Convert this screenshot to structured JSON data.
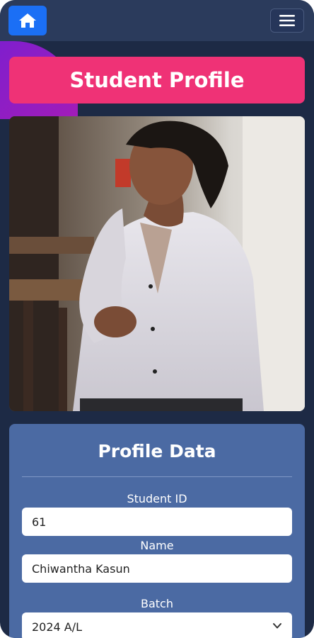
{
  "header": {
    "home_icon": "home-icon",
    "menu_icon": "hamburger-menu-icon",
    "accent": "#1b6ff5"
  },
  "banner": {
    "title": "Student Profile",
    "color": "#ef3276"
  },
  "photo": {
    "alt": "Student photo"
  },
  "profile_data": {
    "heading": "Profile Data",
    "fields": [
      {
        "label": "Student ID",
        "value": "61"
      },
      {
        "label": "Name",
        "value": "Chiwantha Kasun"
      },
      {
        "label": "Batch",
        "value": "2024 A/L"
      }
    ],
    "card_color": "#4b6aa3"
  }
}
